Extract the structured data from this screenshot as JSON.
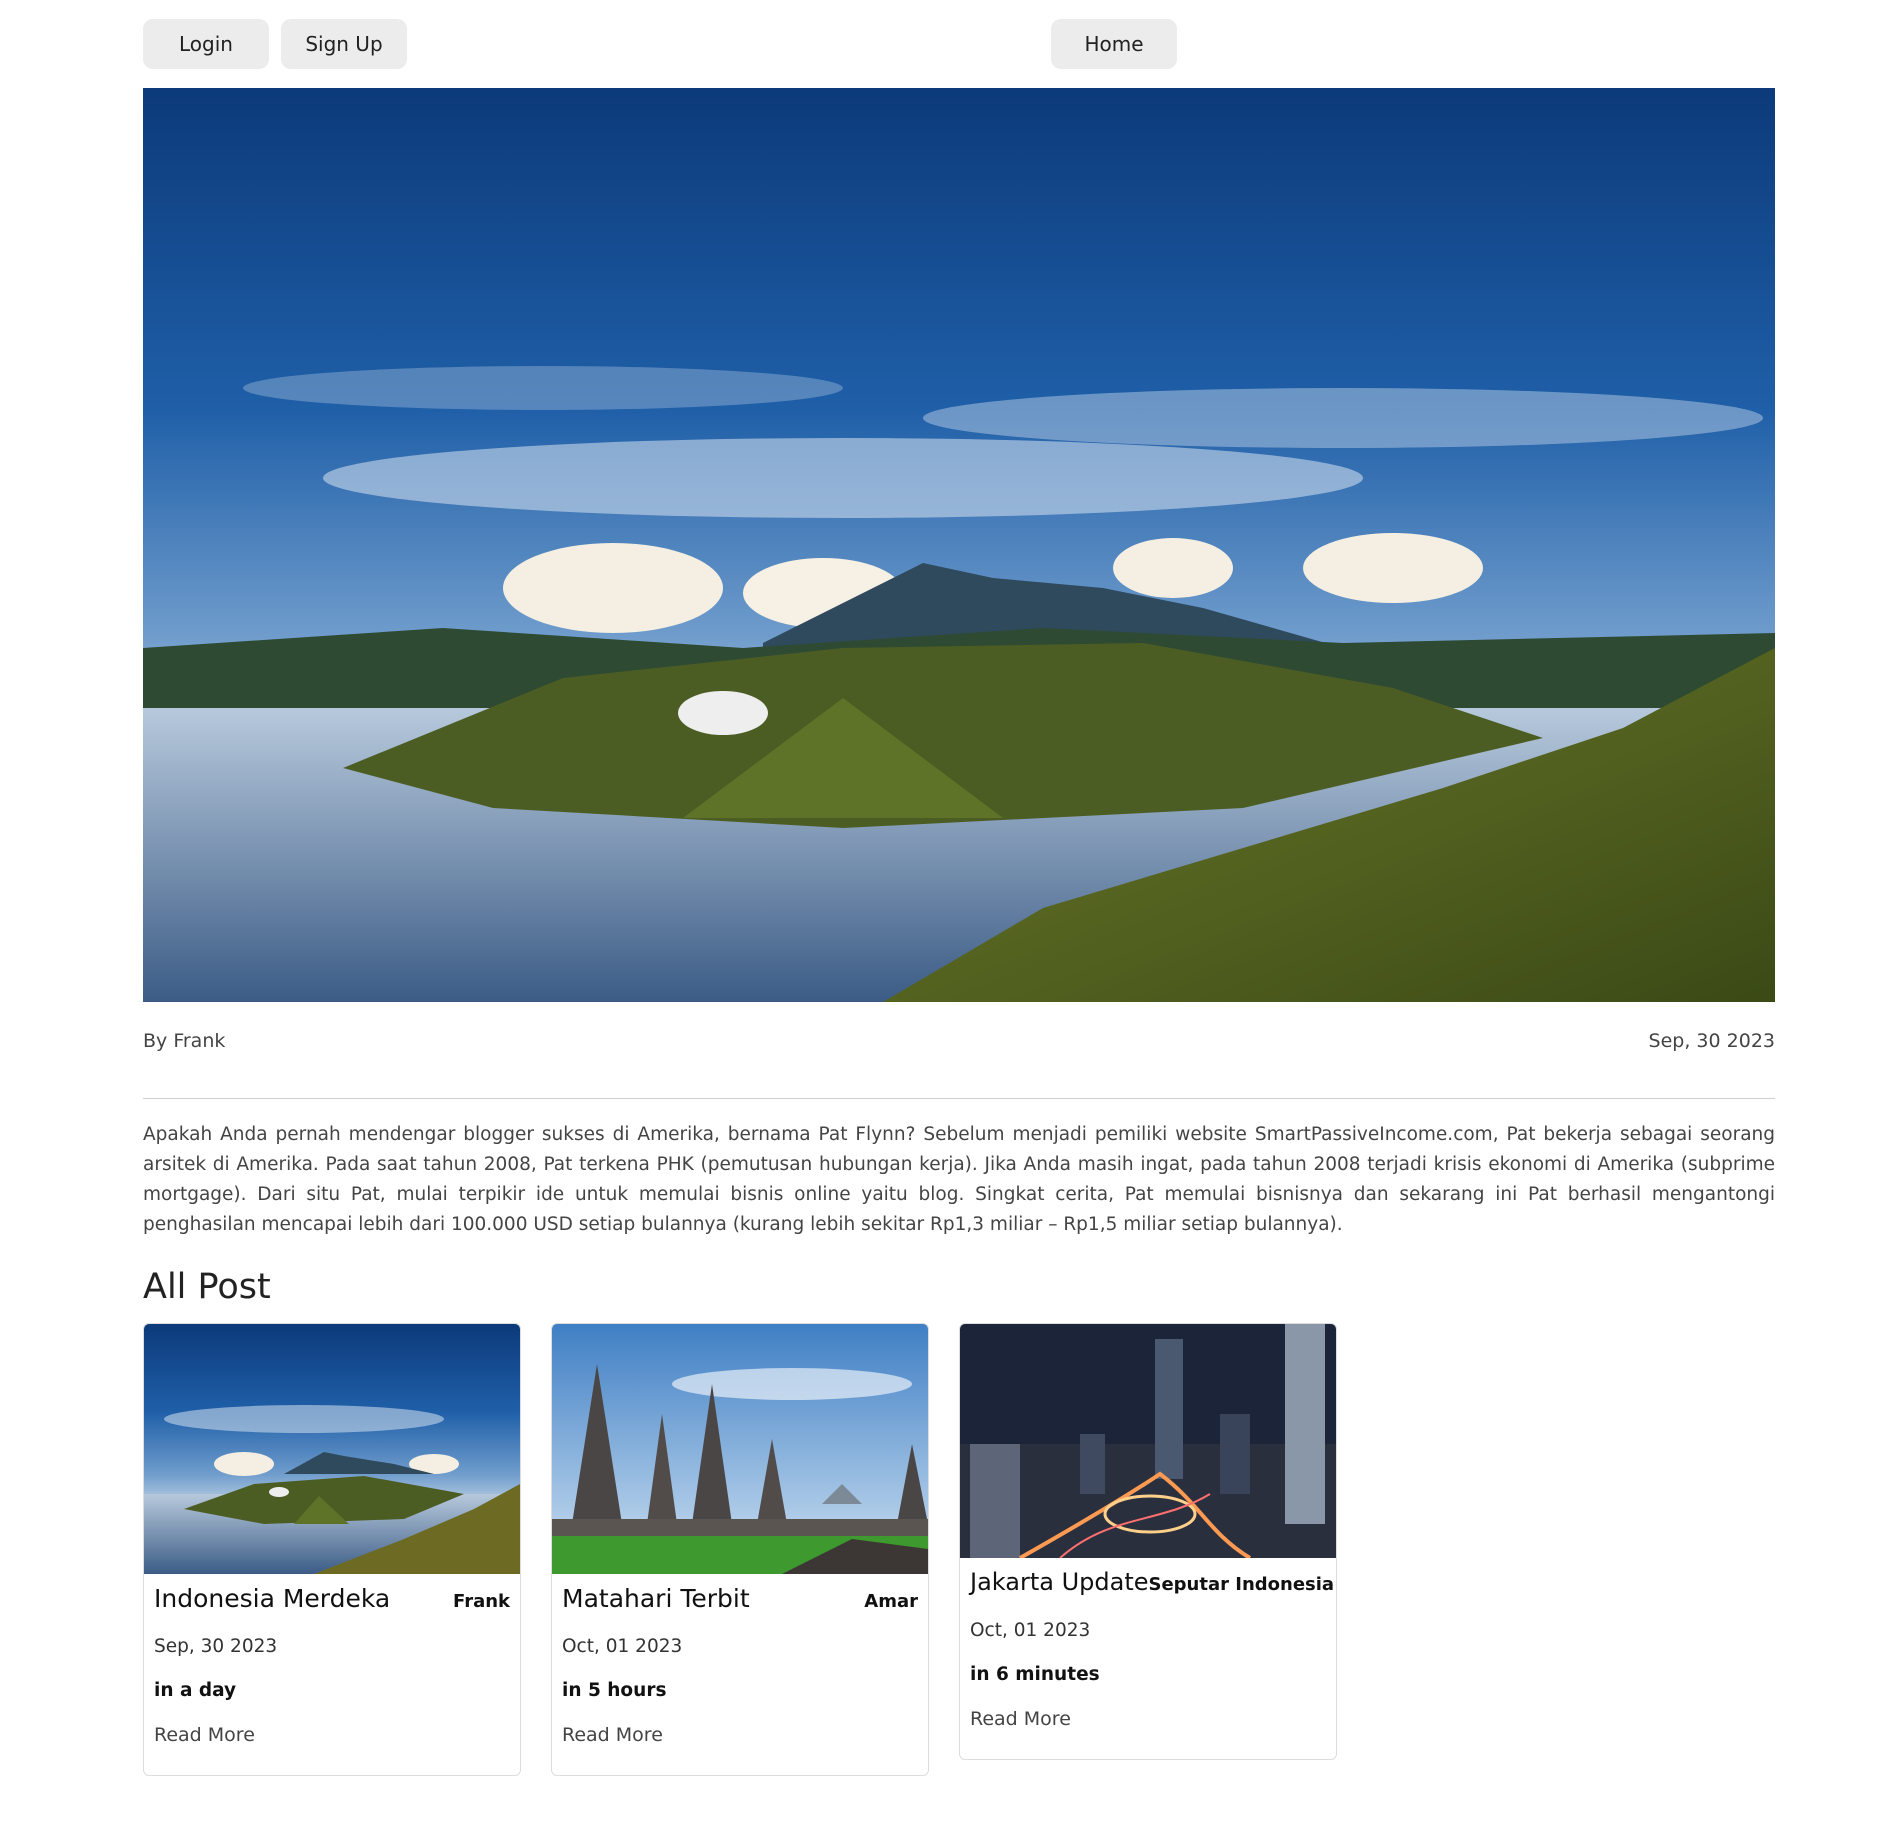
{
  "nav": {
    "login_label": "Login",
    "signup_label": "Sign Up",
    "home_label": "Home"
  },
  "article": {
    "author": "By Frank",
    "date": "Sep, 30 2023",
    "body": "Apakah Anda pernah mendengar blogger sukses di Amerika, bernama Pat Flynn? Sebelum menjadi pemiliki website SmartPassiveIncome.com, Pat bekerja sebagai seorang arsitek di Amerika. Pada saat tahun 2008, Pat terkena PHK (pemutusan hubungan kerja). Jika Anda masih ingat, pada tahun 2008 terjadi krisis ekonomi di Amerika (subprime mortgage). Dari situ Pat, mulai terpikir ide untuk memulai bisnis online yaitu blog. Singkat cerita, Pat memulai bisnisnya dan sekarang ini Pat berhasil mengantongi penghasilan mencapai lebih dari 100.000 USD setiap bulannya (kurang lebih sekitar Rp1,3 miliar – Rp1,5 miliar setiap bulannya)."
  },
  "posts": {
    "section_title": "All Post",
    "items": [
      {
        "title": "Indonesia Merdeka",
        "author": "Frank",
        "date": "Sep, 30 2023",
        "relative": "in a day",
        "link": "Read More"
      },
      {
        "title": "Matahari Terbit",
        "author": "Amar",
        "date": "Oct, 01 2023",
        "relative": "in 5 hours",
        "link": "Read More"
      },
      {
        "title": "Jakarta Update",
        "author": "Seputar Indonesia",
        "date": "Oct, 01 2023",
        "relative": "in 6 minutes",
        "link": "Read More"
      }
    ]
  },
  "colors": {
    "button_bg": "#ececec",
    "sky_blue": "#0f4a8c",
    "text": "#444444"
  }
}
